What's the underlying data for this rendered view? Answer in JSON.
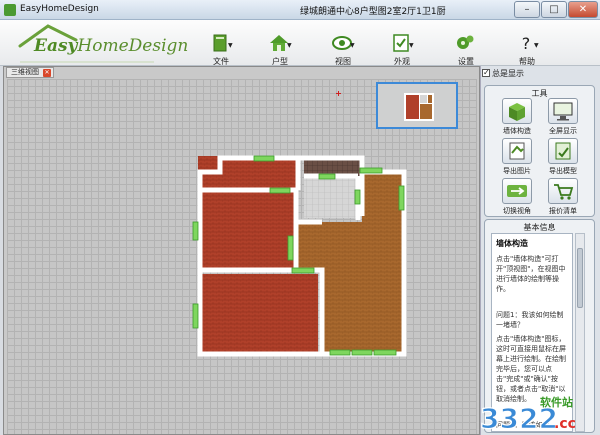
{
  "window": {
    "app_title": "EasyHomeDesign",
    "doc_title": "绿城朗通中心8户型图2室2厅1卫1厨",
    "minimize": "–",
    "maximize": "□",
    "close": "✕"
  },
  "logo": {
    "part1": "Easy",
    "part2": "HomeDesign"
  },
  "toolbar": [
    {
      "label": "文件",
      "icon": "document-icon"
    },
    {
      "label": "户型",
      "icon": "house-icon"
    },
    {
      "label": "视图",
      "icon": "eye-icon"
    },
    {
      "label": "外观",
      "icon": "appearance-icon"
    },
    {
      "label": "设置",
      "icon": "gear-icon"
    },
    {
      "label": "帮助",
      "icon": "help-icon"
    }
  ],
  "tab": {
    "label": "三维视图",
    "close": "✕"
  },
  "options": {
    "show_all": "总是显示"
  },
  "tools_panel": {
    "title": "工具",
    "buttons": [
      {
        "label": "墙体构造",
        "icon": "wall-build-icon"
      },
      {
        "label": "全屏显示",
        "icon": "fullscreen-icon"
      },
      {
        "label": "导出图片",
        "icon": "export-image-icon"
      },
      {
        "label": "导出模型",
        "icon": "export-model-icon"
      },
      {
        "label": "切换视角",
        "icon": "switch-view-icon"
      },
      {
        "label": "报价清单",
        "icon": "cart-icon"
      }
    ]
  },
  "info_panel": {
    "title": "基本信息",
    "heading": "墙体构造",
    "paragraphs": [
      "点击\"墙体构造\"可打开\"顶视图\"，在视图中进行墙体的绘制等操作。",
      "问题1：我该如何绘制一堵墙？",
      "点击\"墙体构造\"图标，这时可直接用鼠标在屏幕上进行绘制。在绘制完毕后，您可以点击\"完成\"或\"确认\"按钮，或者点击\"取消\"以取消绘制。",
      "问题2：我该如何"
    ]
  },
  "watermark": {
    "brand": "3322",
    "suffix": ".cc",
    "tag": "软件站"
  }
}
